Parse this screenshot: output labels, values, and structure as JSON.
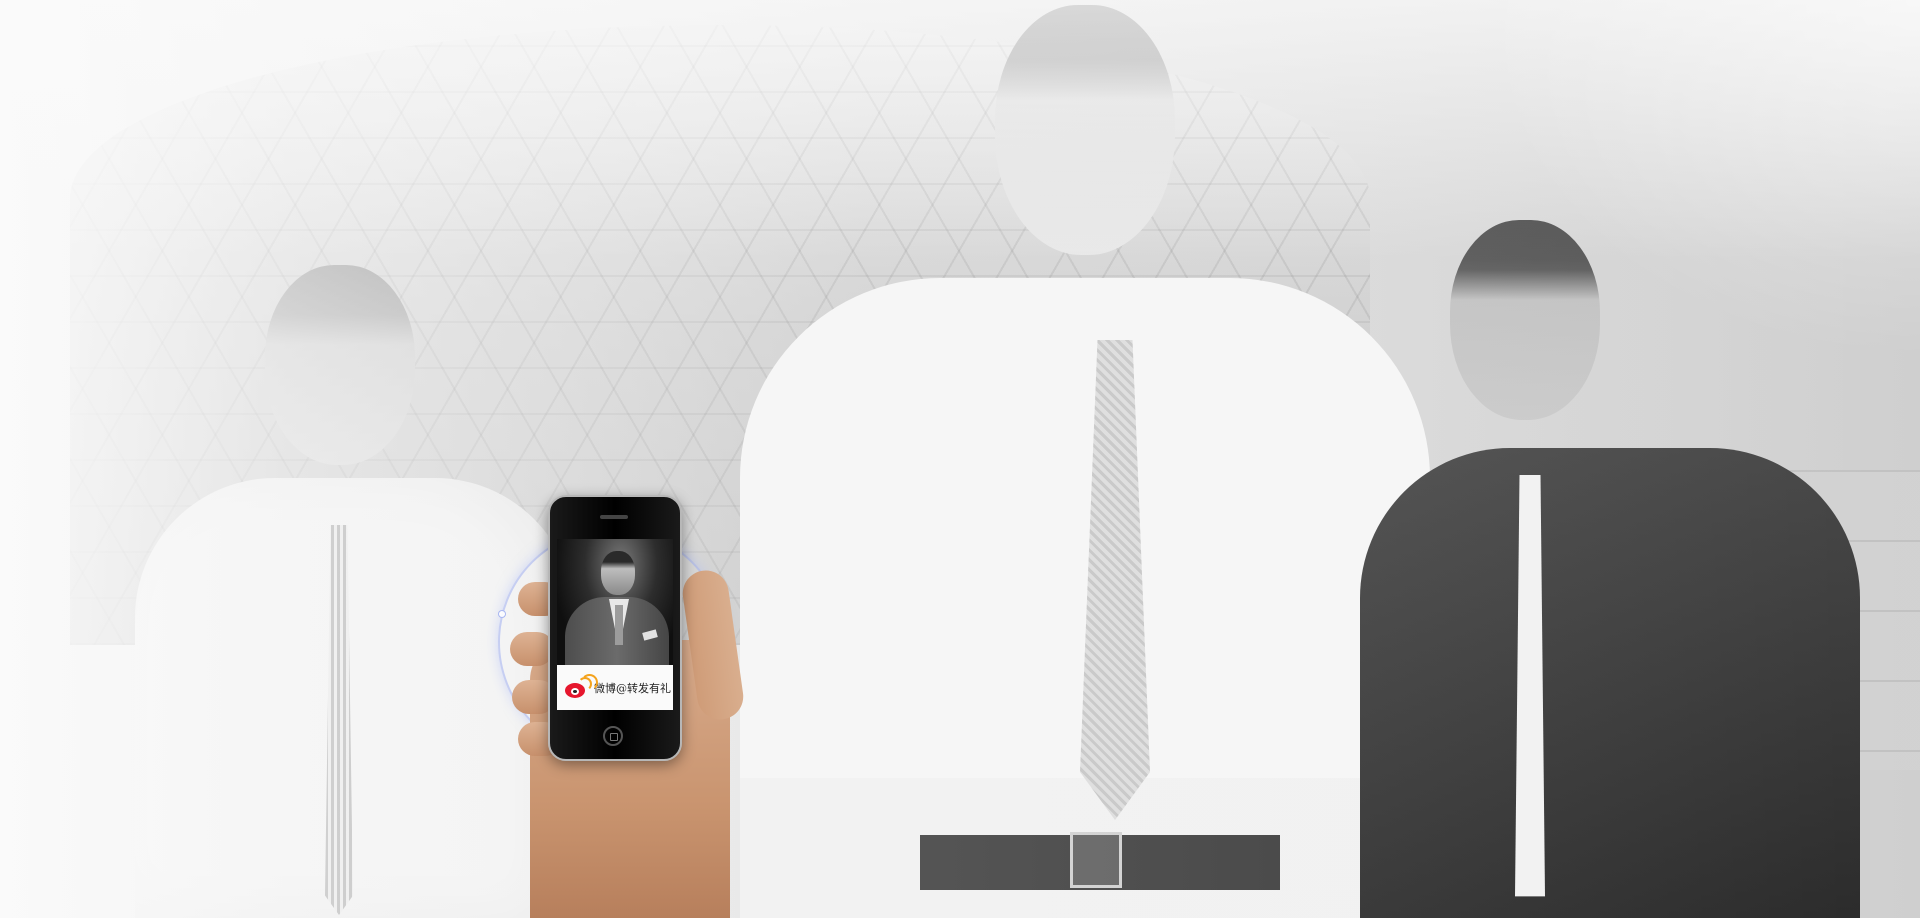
{
  "promo": {
    "banner_text": "微博@转发有礼"
  },
  "colors": {
    "weibo_red": "#e6162d",
    "weibo_orange": "#f4a31d",
    "ring_glow": "#a0aff0",
    "background": "#e9e9e9"
  },
  "icons": [
    "weibo-icon",
    "phone-home-button-icon"
  ]
}
